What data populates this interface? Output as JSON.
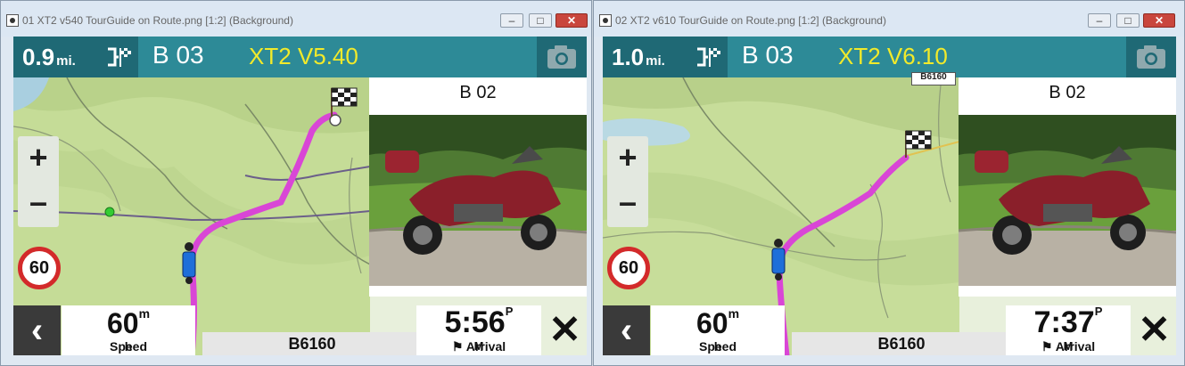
{
  "windows": [
    {
      "title": "01 XT2 v540 TourGuide on Route.png [1:2] (Background)",
      "controls": [
        "–",
        "□",
        "✕"
      ],
      "screen": {
        "distance": "0.9",
        "distance_unit": "mi.",
        "route_point": "B 03",
        "version_label": "XT2 V5.40",
        "next_point": "B 02",
        "zoom_in": "+",
        "zoom_out": "–",
        "speed_limit": "60",
        "back": "‹",
        "speed_value": "60",
        "speed_unit_top": "m",
        "speed_unit_bottom": "h",
        "speed_label": "Speed",
        "road_name": "B6160",
        "arrival_time": "5:56",
        "arrival_ampm_top": "P",
        "arrival_ampm_bottom": "M",
        "arrival_label": "Arrival",
        "cancel": "✕"
      }
    },
    {
      "title": "02 XT2 v610 TourGuide on Route.png [1:2] (Background)",
      "controls": [
        "–",
        "□",
        "✕"
      ],
      "screen": {
        "distance": "1.0",
        "distance_unit": "mi.",
        "route_point": "B 03",
        "version_label": "XT2 V6.10",
        "next_point": "B 02",
        "map_marker": "B6160",
        "zoom_in": "+",
        "zoom_out": "–",
        "speed_limit": "60",
        "back": "‹",
        "speed_value": "60",
        "speed_unit_top": "m",
        "speed_unit_bottom": "h",
        "speed_label": "Speed",
        "road_name": "B6160",
        "arrival_time": "7:37",
        "arrival_ampm_top": "P",
        "arrival_ampm_bottom": "M",
        "arrival_label": "Arrival",
        "cancel": "✕"
      }
    }
  ],
  "colors": {
    "topbar": "#2d8a97",
    "topbar_dark": "#1f6975",
    "version_text": "#f2ea2a",
    "route_line": "#d946d6",
    "map_land": "#c7dd9a",
    "speed_sign_ring": "#d32a2a"
  },
  "icons": [
    "turn-finish-icon",
    "camera-icon",
    "finish-flag-icon",
    "motorcycle-position-icon",
    "back-arrow-icon",
    "close-icon",
    "checkered-flag-icon"
  ]
}
